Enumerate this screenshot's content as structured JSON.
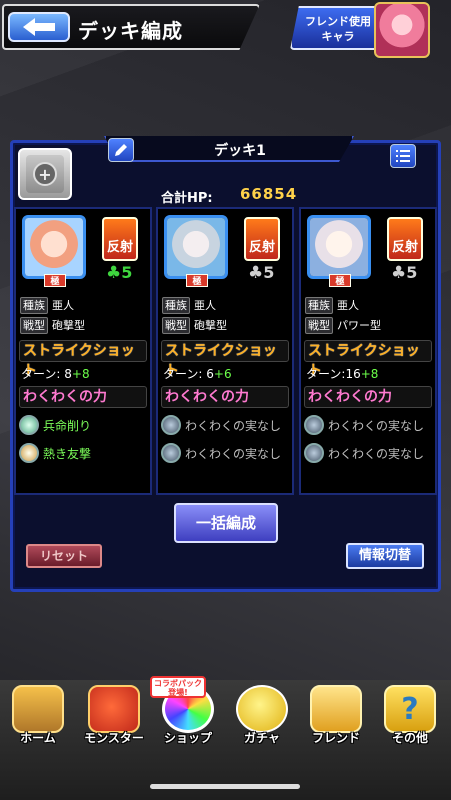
{
  "header": {
    "title": "デッキ編成",
    "friend_button": [
      "フレンド使用",
      "キャラ"
    ]
  },
  "deck": {
    "name": "デッキ1",
    "hp_label": "合計HP:",
    "hp_value": "66854"
  },
  "columns": [
    {
      "kyoku": "極",
      "element": "反射",
      "luck": "5",
      "luck_color": "green",
      "race_label": "種族",
      "race": "亜人",
      "type_label": "戦型",
      "type": "砲撃型",
      "ss_label": "ストライクショット",
      "turn_base": "ターン: 8",
      "turn_plus": "+8",
      "waku_label": "わくわくの力",
      "abilities": [
        "兵命削り",
        "熱き友撃"
      ],
      "abilities_color": "green"
    },
    {
      "kyoku": "極",
      "element": "反射",
      "luck": "5",
      "luck_color": "gray",
      "race_label": "種族",
      "race": "亜人",
      "type_label": "戦型",
      "type": "砲撃型",
      "ss_label": "ストライクショット",
      "turn_base": "ターン: 6",
      "turn_plus": "+6",
      "waku_label": "わくわくの力",
      "abilities": [
        "わくわくの実なし",
        "わくわくの実なし"
      ],
      "abilities_color": "gray"
    },
    {
      "kyoku": "極",
      "element": "反射",
      "luck": "5",
      "luck_color": "gray",
      "race_label": "種族",
      "race": "亜人",
      "type_label": "戦型",
      "type": "パワー型",
      "ss_label": "ストライクショット",
      "turn_base": "ターン:16",
      "turn_plus": "+8",
      "waku_label": "わくわくの力",
      "abilities": [
        "わくわくの実なし",
        "わくわくの実なし"
      ],
      "abilities_color": "gray"
    }
  ],
  "buttons": {
    "bulk": "一括編成",
    "reset": "リセット",
    "info": "情報切替"
  },
  "nav": {
    "collab_badge": [
      "コラボパック",
      "登場!"
    ],
    "items": [
      "ホーム",
      "モンスター",
      "ショップ",
      "ガチャ",
      "フレンド",
      "その他"
    ]
  },
  "colors": {
    "panel_border": "#2540b8",
    "gold_text": "#ffd24a",
    "ss_orange": "#ffb020",
    "waku_pink": "#ff7ad0",
    "plus_green": "#6cff4a"
  }
}
